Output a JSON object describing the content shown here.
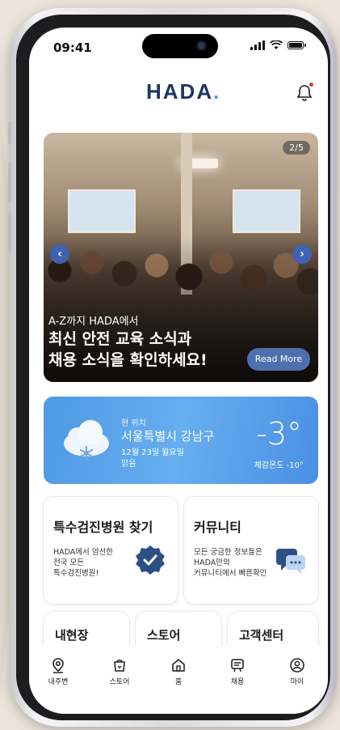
{
  "status_bar": {
    "time": "09:41"
  },
  "header": {
    "logo_text": "HADA",
    "logo_dot": "."
  },
  "banner": {
    "counter": "2/5",
    "subtitle": "A-Z까지 HADA에서",
    "title_line1": "최신 안전 교육 소식과",
    "title_line2": "채용 소식을 확인하세요!",
    "read_more": "Read More",
    "prev_glyph": "‹",
    "next_glyph": "›"
  },
  "weather": {
    "label": "현 위치",
    "location": "서울특별시 강남구",
    "date": "12월 23일 월요일",
    "condition": "맑음",
    "temperature": "-3°",
    "feels_like": "체감온도 -10°"
  },
  "cards": {
    "hospital": {
      "title": "특수검진병원 찾기",
      "desc_1": "HADA에서 엄선한",
      "desc_2": "전국 모든",
      "desc_3": "특수검진병원!"
    },
    "community": {
      "title": "커뮤니티",
      "desc_1": "모든 궁금한 정보들은",
      "desc_2": "HADA만의",
      "desc_3": "커뮤니티에서 빠른확인"
    },
    "site": {
      "title": "내현장"
    },
    "store": {
      "title": "스토어"
    },
    "help": {
      "title": "고객센터"
    }
  },
  "tabbar": {
    "items": [
      {
        "label": "내주변"
      },
      {
        "label": "스토어"
      },
      {
        "label": "홈"
      },
      {
        "label": "채용"
      },
      {
        "label": "마이"
      }
    ]
  },
  "colors": {
    "brand": "#1f3561",
    "accent": "#37a3e2",
    "weather_bg": "#4f9ae6",
    "badge": "#2e4f86"
  }
}
